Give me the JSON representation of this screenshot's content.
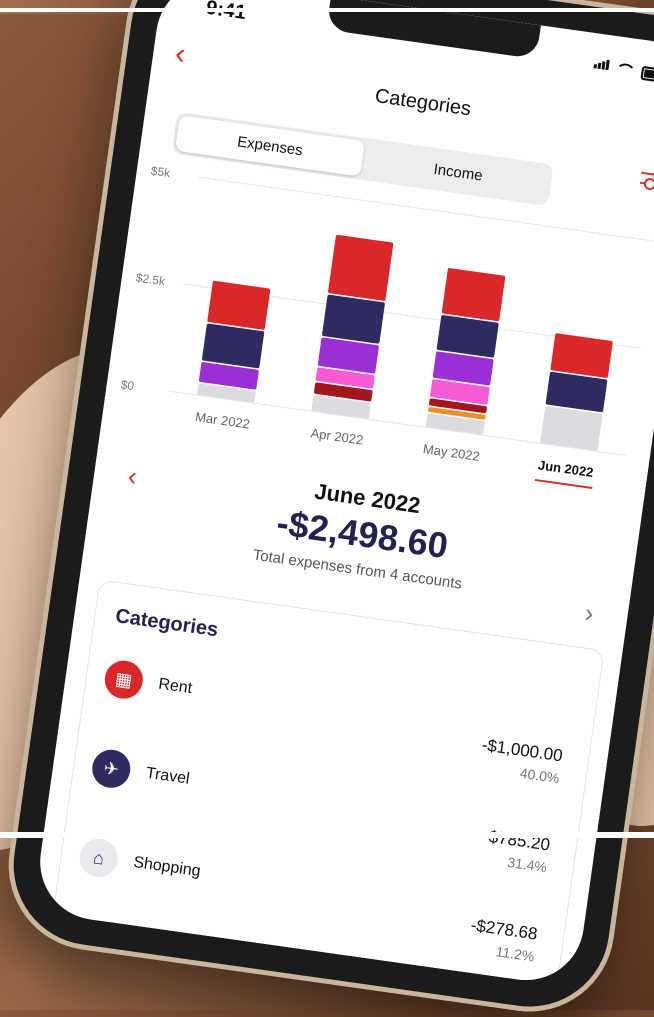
{
  "status_bar": {
    "time": "9:41"
  },
  "header": {
    "title": "Categories"
  },
  "tabs": [
    {
      "label": "Expenses",
      "active": true
    },
    {
      "label": "Income",
      "active": false
    }
  ],
  "chart_data": {
    "type": "bar",
    "stacked": true,
    "categories": [
      "Mar 2022",
      "Apr 2022",
      "May 2022",
      "Jun 2022"
    ],
    "selected_category": "Jun 2022",
    "y_ticks": [
      "$5k",
      "$2.5k",
      "$0"
    ],
    "ylim": [
      0,
      5000
    ],
    "series": [
      {
        "color": "#dcdce0",
        "values": [
          300,
          400,
          350,
          900
        ]
      },
      {
        "color": "#f28c28",
        "values": [
          0,
          0,
          150,
          0
        ]
      },
      {
        "color": "#a3161d",
        "values": [
          0,
          300,
          200,
          0
        ]
      },
      {
        "color": "#f55cd6",
        "values": [
          0,
          350,
          450,
          0
        ]
      },
      {
        "color": "#9b2fd6",
        "values": [
          500,
          700,
          650,
          0
        ]
      },
      {
        "color": "#2e2b60",
        "values": [
          900,
          1000,
          850,
          800
        ]
      },
      {
        "color": "#d9272a",
        "values": [
          1000,
          1400,
          1100,
          900
        ]
      }
    ]
  },
  "summary": {
    "month": "June 2022",
    "amount": "-$2,498.60",
    "subtitle": "Total expenses from 4 accounts"
  },
  "categories_card": {
    "title": "Categories",
    "items": [
      {
        "name": "Rent",
        "amount": "-$1,000.00",
        "percent": "40.0%",
        "icon": "building-icon",
        "color": "#d9272a"
      },
      {
        "name": "Travel",
        "amount": "-$785.20",
        "percent": "31.4%",
        "icon": "airplane-icon",
        "color": "#2e2b60"
      },
      {
        "name": "Shopping",
        "amount": "-$278.68",
        "percent": "11.2%",
        "icon": "store-icon",
        "color": "#e9e9ee"
      }
    ]
  }
}
